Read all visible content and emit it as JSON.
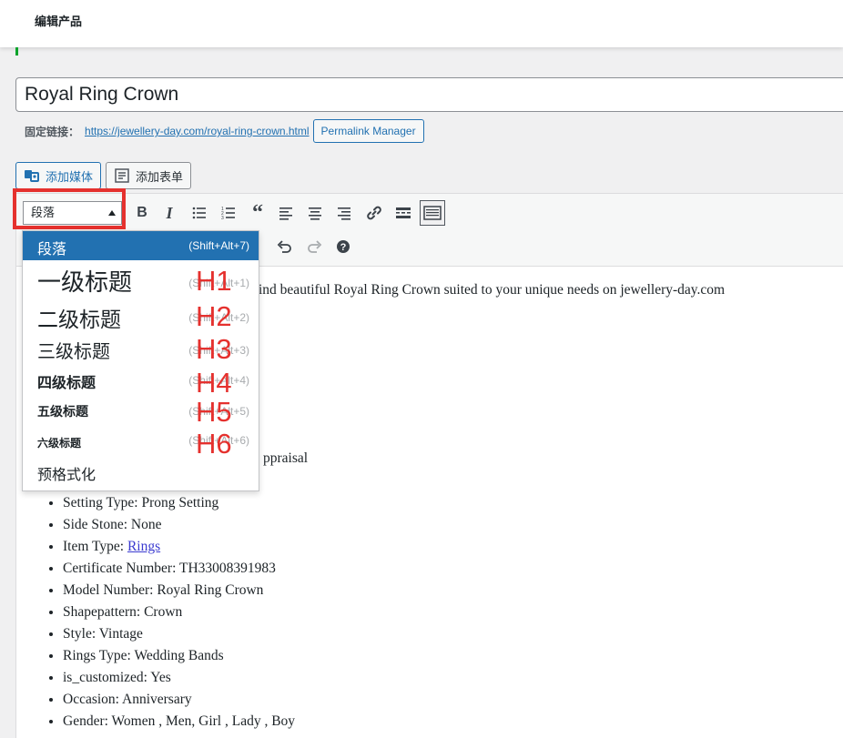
{
  "header": {
    "title": "编辑产品"
  },
  "post": {
    "title": "Royal Ring Crown",
    "permalink_label": "固定链接：",
    "permalink_url": "https://jewellery-day.com/royal-ring-crown.html",
    "permalink_manager": "Permalink Manager"
  },
  "media_buttons": {
    "add_media": "添加媒体",
    "add_form": "添加表单"
  },
  "toolbar": {
    "format_value": "段落",
    "icons_row1": [
      "bold-icon",
      "italic-icon",
      "bulleted-list-icon",
      "numbered-list-icon",
      "blockquote-icon",
      "align-left-icon",
      "align-center-icon",
      "align-right-icon",
      "link-icon",
      "read-more-icon",
      "toolbar-toggle-icon"
    ],
    "icons_row2": [
      "undo-icon",
      "redo-icon",
      "help-icon"
    ]
  },
  "format_menu": [
    {
      "label": "段落",
      "shortcut": "(Shift+Alt+7)",
      "selected": true
    },
    {
      "label": "一级标题",
      "shortcut": "(Shift+Alt+1)",
      "annotation": "H1"
    },
    {
      "label": "二级标题",
      "shortcut": "(Shift+Alt+2)",
      "annotation": "H2"
    },
    {
      "label": "三级标题",
      "shortcut": "(Shift+Alt+3)",
      "annotation": "H3"
    },
    {
      "label": "四级标题",
      "shortcut": "(Shift+Alt+4)",
      "annotation": "H4"
    },
    {
      "label": "五级标题",
      "shortcut": "(Shift+Alt+5)",
      "annotation": "H5"
    },
    {
      "label": "六级标题",
      "shortcut": "(Shift+Alt+6)",
      "annotation": "H6"
    },
    {
      "label": "预格式化"
    }
  ],
  "content": {
    "intro_visible": "ind beautiful Royal Ring Crown suited to your unique needs on jewellery-day.com",
    "appraisal_visible": "ppraisal",
    "specs": [
      {
        "text": "Setting Type: Prong Setting"
      },
      {
        "text": "Side Stone: None"
      },
      {
        "prefix": "Item Type: ",
        "link": "Rings"
      },
      {
        "text": "Certificate Number: TH33008391983"
      },
      {
        "text": "Model Number: Royal Ring Crown"
      },
      {
        "text": "Shapepattern: Crown"
      },
      {
        "text": "Style: Vintage"
      },
      {
        "text": "Rings Type: Wedding Bands"
      },
      {
        "text": "is_customized: Yes"
      },
      {
        "text": "Occasion: Anniversary"
      },
      {
        "text": "Gender: Women , Men, Girl , Lady , Boy"
      }
    ]
  },
  "colors": {
    "accent": "#2271b1",
    "highlight_red": "#e5312e",
    "success_green": "#00a32a"
  }
}
